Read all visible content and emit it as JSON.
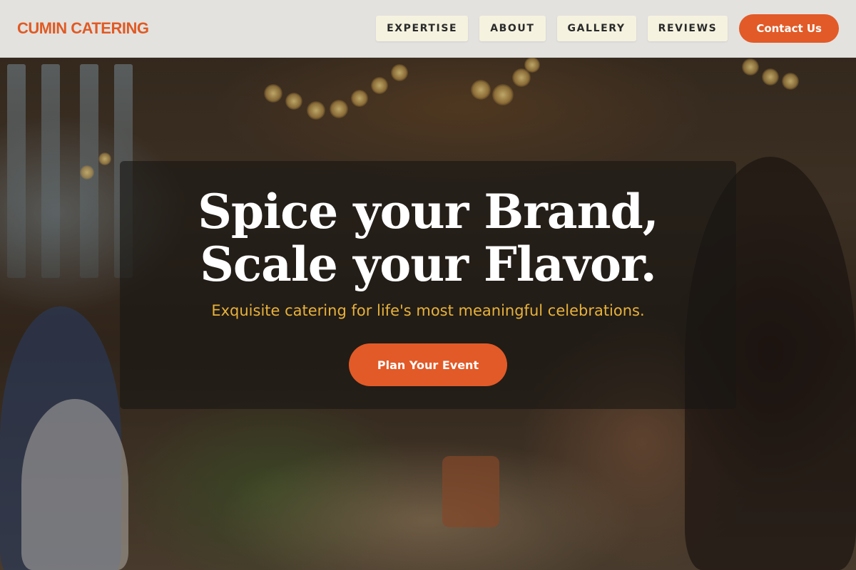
{
  "header": {
    "brand": "CUMIN CATERING",
    "nav": [
      {
        "label": "EXPERTISE"
      },
      {
        "label": "ABOUT"
      },
      {
        "label": "GALLERY"
      },
      {
        "label": "REVIEWS"
      }
    ],
    "contact_label": "Contact Us"
  },
  "hero": {
    "title": "Spice your Brand, Scale your Flavor.",
    "subtitle": "Exquisite catering for life's most meaningful celebrations.",
    "cta_label": "Plan Your Event",
    "background_image": "blurred banquet hall with string lights, guests toasting and table floral arrangements"
  },
  "colors": {
    "brand": "#e05a24",
    "accent": "#e25a27",
    "subtitle": "#e7b23a",
    "nav_bg": "#f5f2df"
  }
}
